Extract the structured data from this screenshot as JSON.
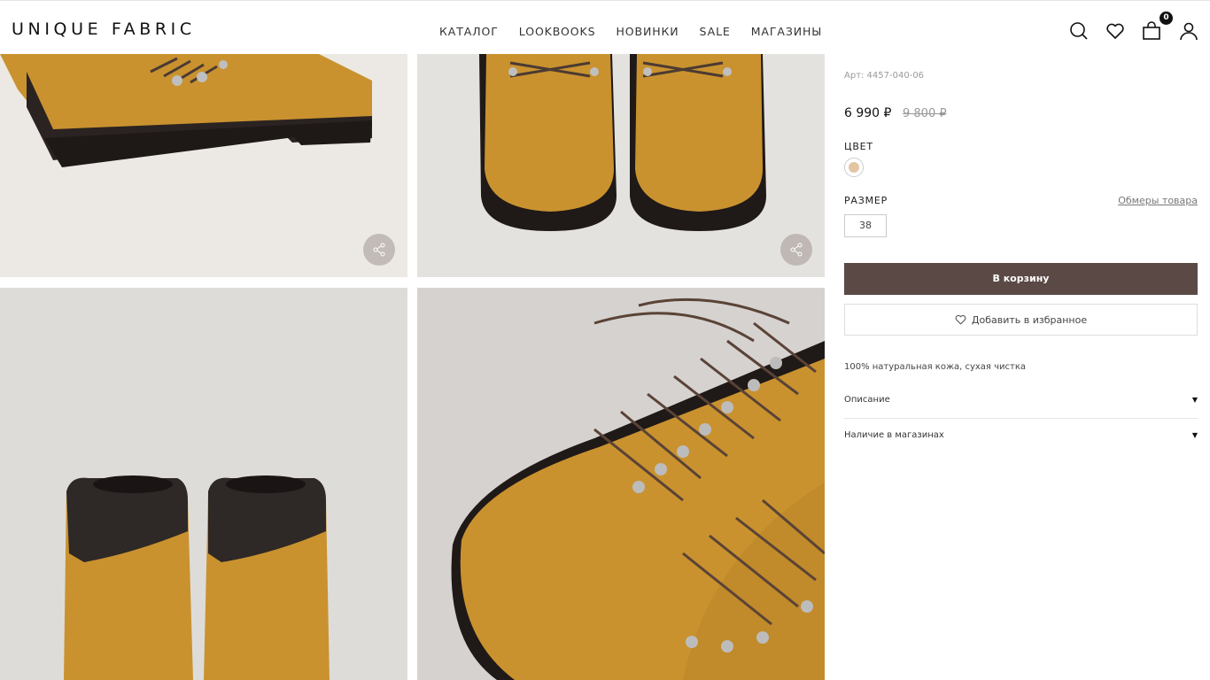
{
  "brand": {
    "name": "UNIQUE FABRIC"
  },
  "nav": [
    {
      "label": "КАТАЛОГ"
    },
    {
      "label": "LOOKBOOKS"
    },
    {
      "label": "НОВИНКИ"
    },
    {
      "label": "SALE"
    },
    {
      "label": "МАГАЗИНЫ"
    }
  ],
  "header_icons": [
    "search-icon",
    "heart-icon",
    "bag-icon",
    "user-icon"
  ],
  "cart": {
    "count": "0"
  },
  "product": {
    "article": "Арт: 4457-040-06",
    "price": "6 990 ₽",
    "old_price": "9 800 ₽",
    "color_label": "ЦВЕТ",
    "color_swatch": "#e3c4a3",
    "size_label": "РАЗМЕР",
    "measure_link": "Обмеры товара",
    "size": "38",
    "add_to_cart": "В корзину",
    "add_to_favorites": "Добавить в избранное",
    "material": "100% натуральная кожа, сухая чистка",
    "accordion": [
      {
        "label": "Описание"
      },
      {
        "label": "Наличие в магазинах"
      }
    ]
  },
  "colors": {
    "cart_button": "#5a4945",
    "boot_suede": "#c9922f"
  }
}
